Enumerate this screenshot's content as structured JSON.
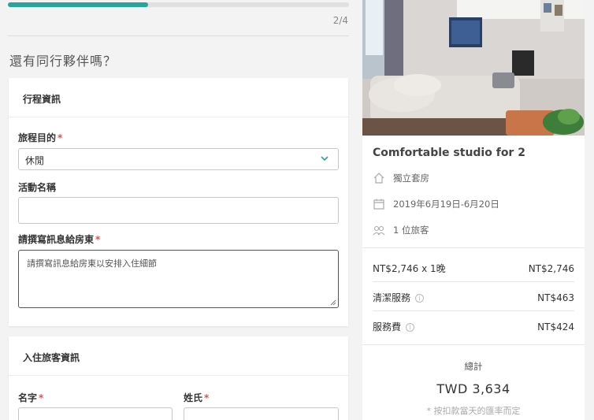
{
  "progress": {
    "fraction": 0.41,
    "step_text": "2/4"
  },
  "page_title": "還有同行夥伴嗎？",
  "trip_card": {
    "heading": "行程資訊",
    "purpose_label": "旅程目的",
    "purpose_value": "休閒",
    "activity_label": "活動名稱",
    "activity_value": "",
    "message_label": "請撰寫訊息給房東",
    "message_placeholder": "請撰寫訊息給房東以安排入住細節",
    "required_mark": "*"
  },
  "guest_card": {
    "heading": "入住旅客資訊",
    "first_name_label": "名字",
    "last_name_label": "姓氏",
    "required_mark": "*"
  },
  "listing": {
    "title": "Comfortable studio for 2",
    "room_type": "獨立套房",
    "dates": "2019年6月19日-6月20日",
    "guests": "1 位旅客",
    "icons": [
      "house-icon",
      "calendar-icon",
      "guests-icon"
    ]
  },
  "price": {
    "nightly_label": "NT$2,746 x 1晚",
    "nightly_value": "NT$2,746",
    "cleaning_label": "清潔服務",
    "cleaning_value": "NT$463",
    "service_label": "服務費",
    "service_value": "NT$424",
    "total_label": "總計",
    "total_value": "TWD 3,634",
    "total_note": "* 按扣款當天的匯率而定"
  },
  "colors": {
    "accent": "#26a69a",
    "required": "#d9534f"
  }
}
